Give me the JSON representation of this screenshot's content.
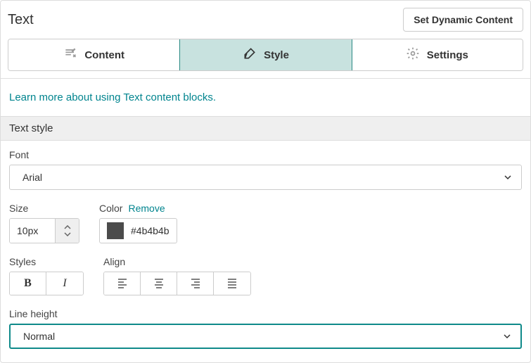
{
  "header": {
    "title": "Text",
    "dynamic_button": "Set Dynamic Content"
  },
  "tabs": {
    "content": "Content",
    "style": "Style",
    "settings": "Settings",
    "active": "style"
  },
  "help_link": "Learn more about using Text content blocks.",
  "section": {
    "title": "Text style"
  },
  "font": {
    "label": "Font",
    "value": "Arial"
  },
  "size": {
    "label": "Size",
    "value": "10px"
  },
  "color": {
    "label": "Color",
    "remove": "Remove",
    "hex": "#4b4b4b"
  },
  "styles": {
    "label": "Styles",
    "bold": "B",
    "italic": "I"
  },
  "align": {
    "label": "Align"
  },
  "line_height": {
    "label": "Line height",
    "value": "Normal"
  }
}
